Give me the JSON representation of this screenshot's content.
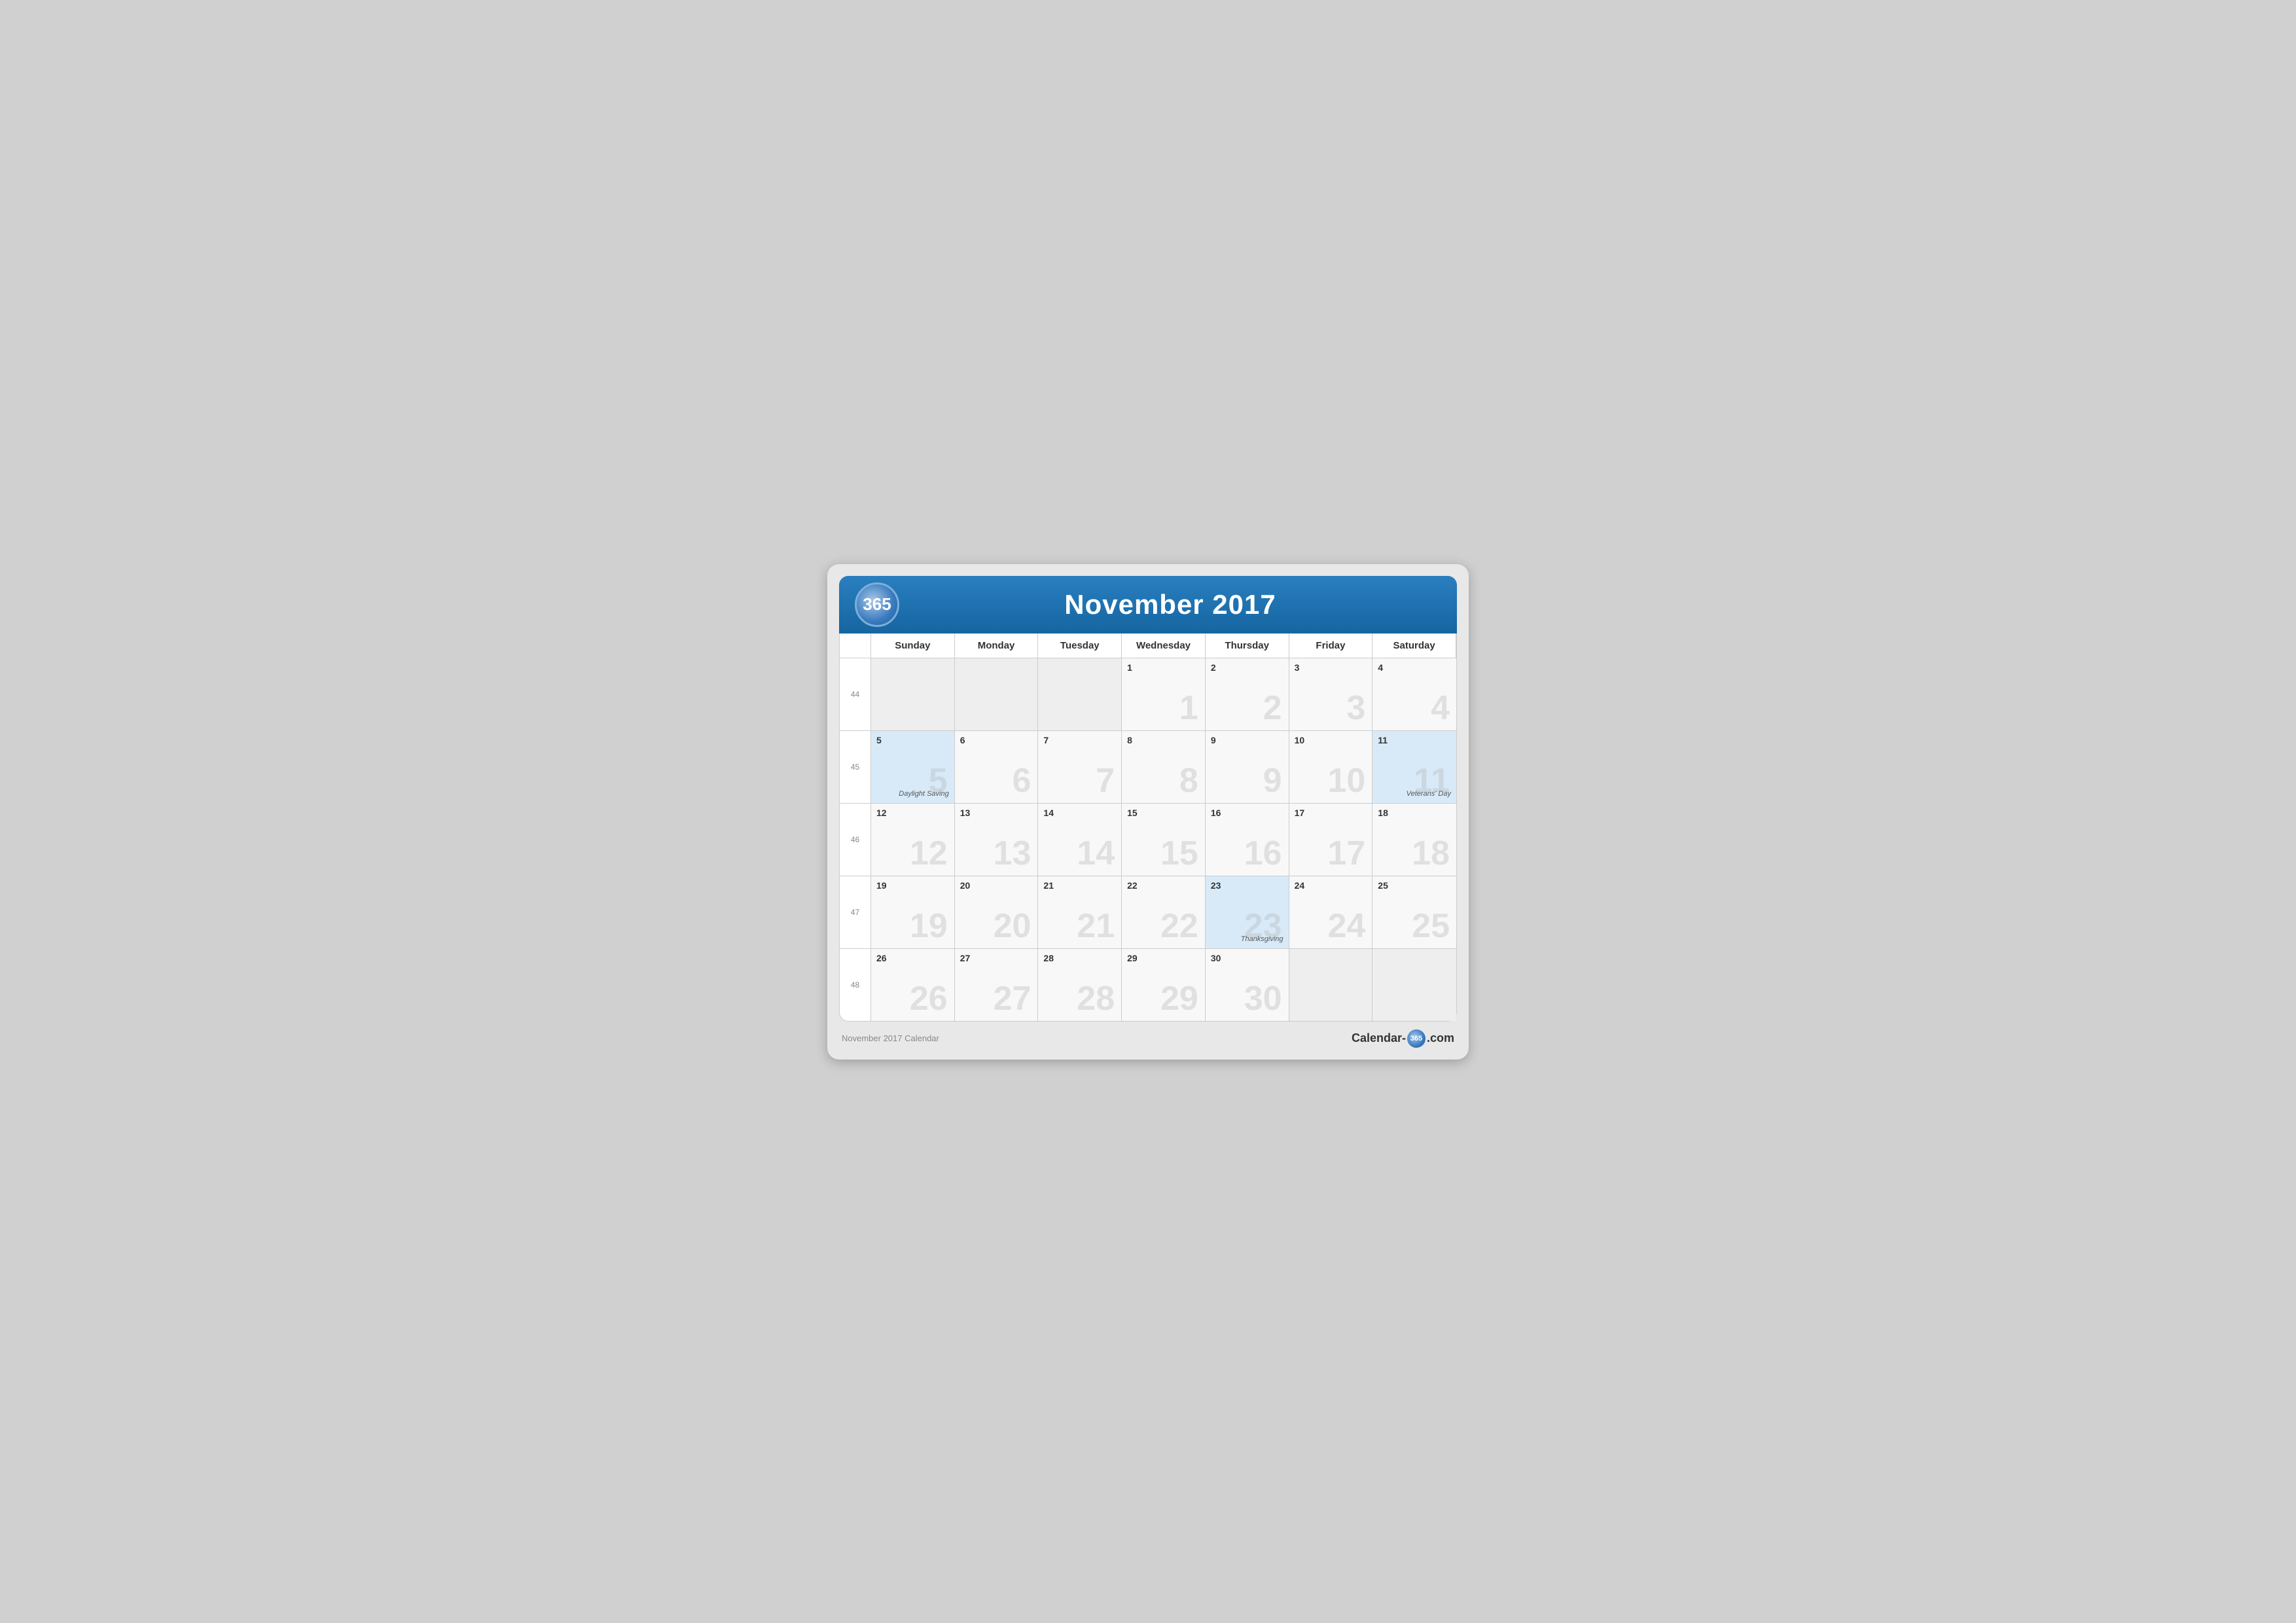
{
  "header": {
    "logo": "365",
    "title": "November 2017"
  },
  "footer": {
    "caption": "November 2017 Calendar",
    "brand_prefix": "Calendar-",
    "brand_badge": "365",
    "brand_suffix": ".com"
  },
  "days_of_week": [
    "Sunday",
    "Monday",
    "Tuesday",
    "Wednesday",
    "Thursday",
    "Friday",
    "Saturday"
  ],
  "weeks": [
    {
      "week_num": "44",
      "days": [
        {
          "date": "",
          "in_month": false,
          "highlight": false,
          "event": ""
        },
        {
          "date": "",
          "in_month": false,
          "highlight": false,
          "event": ""
        },
        {
          "date": "",
          "in_month": false,
          "highlight": false,
          "event": ""
        },
        {
          "date": "1",
          "in_month": true,
          "highlight": false,
          "event": ""
        },
        {
          "date": "2",
          "in_month": true,
          "highlight": false,
          "event": ""
        },
        {
          "date": "3",
          "in_month": true,
          "highlight": false,
          "event": ""
        },
        {
          "date": "4",
          "in_month": true,
          "highlight": false,
          "event": ""
        }
      ]
    },
    {
      "week_num": "45",
      "days": [
        {
          "date": "5",
          "in_month": true,
          "highlight": true,
          "event": "Daylight Saving"
        },
        {
          "date": "6",
          "in_month": true,
          "highlight": false,
          "event": ""
        },
        {
          "date": "7",
          "in_month": true,
          "highlight": false,
          "event": ""
        },
        {
          "date": "8",
          "in_month": true,
          "highlight": false,
          "event": ""
        },
        {
          "date": "9",
          "in_month": true,
          "highlight": false,
          "event": ""
        },
        {
          "date": "10",
          "in_month": true,
          "highlight": false,
          "event": ""
        },
        {
          "date": "11",
          "in_month": true,
          "highlight": true,
          "event": "Veterans' Day"
        }
      ]
    },
    {
      "week_num": "46",
      "days": [
        {
          "date": "12",
          "in_month": true,
          "highlight": false,
          "event": ""
        },
        {
          "date": "13",
          "in_month": true,
          "highlight": false,
          "event": ""
        },
        {
          "date": "14",
          "in_month": true,
          "highlight": false,
          "event": ""
        },
        {
          "date": "15",
          "in_month": true,
          "highlight": false,
          "event": ""
        },
        {
          "date": "16",
          "in_month": true,
          "highlight": false,
          "event": ""
        },
        {
          "date": "17",
          "in_month": true,
          "highlight": false,
          "event": ""
        },
        {
          "date": "18",
          "in_month": true,
          "highlight": false,
          "event": ""
        }
      ]
    },
    {
      "week_num": "47",
      "days": [
        {
          "date": "19",
          "in_month": true,
          "highlight": false,
          "event": ""
        },
        {
          "date": "20",
          "in_month": true,
          "highlight": false,
          "event": ""
        },
        {
          "date": "21",
          "in_month": true,
          "highlight": false,
          "event": ""
        },
        {
          "date": "22",
          "in_month": true,
          "highlight": false,
          "event": ""
        },
        {
          "date": "23",
          "in_month": true,
          "highlight": true,
          "event": "Thanksgiving"
        },
        {
          "date": "24",
          "in_month": true,
          "highlight": false,
          "event": ""
        },
        {
          "date": "25",
          "in_month": true,
          "highlight": false,
          "event": ""
        }
      ]
    },
    {
      "week_num": "48",
      "days": [
        {
          "date": "26",
          "in_month": true,
          "highlight": false,
          "event": ""
        },
        {
          "date": "27",
          "in_month": true,
          "highlight": false,
          "event": ""
        },
        {
          "date": "28",
          "in_month": true,
          "highlight": false,
          "event": ""
        },
        {
          "date": "29",
          "in_month": true,
          "highlight": false,
          "event": ""
        },
        {
          "date": "30",
          "in_month": true,
          "highlight": false,
          "event": ""
        },
        {
          "date": "",
          "in_month": false,
          "highlight": false,
          "event": ""
        },
        {
          "date": "",
          "in_month": false,
          "highlight": false,
          "event": ""
        }
      ]
    }
  ]
}
